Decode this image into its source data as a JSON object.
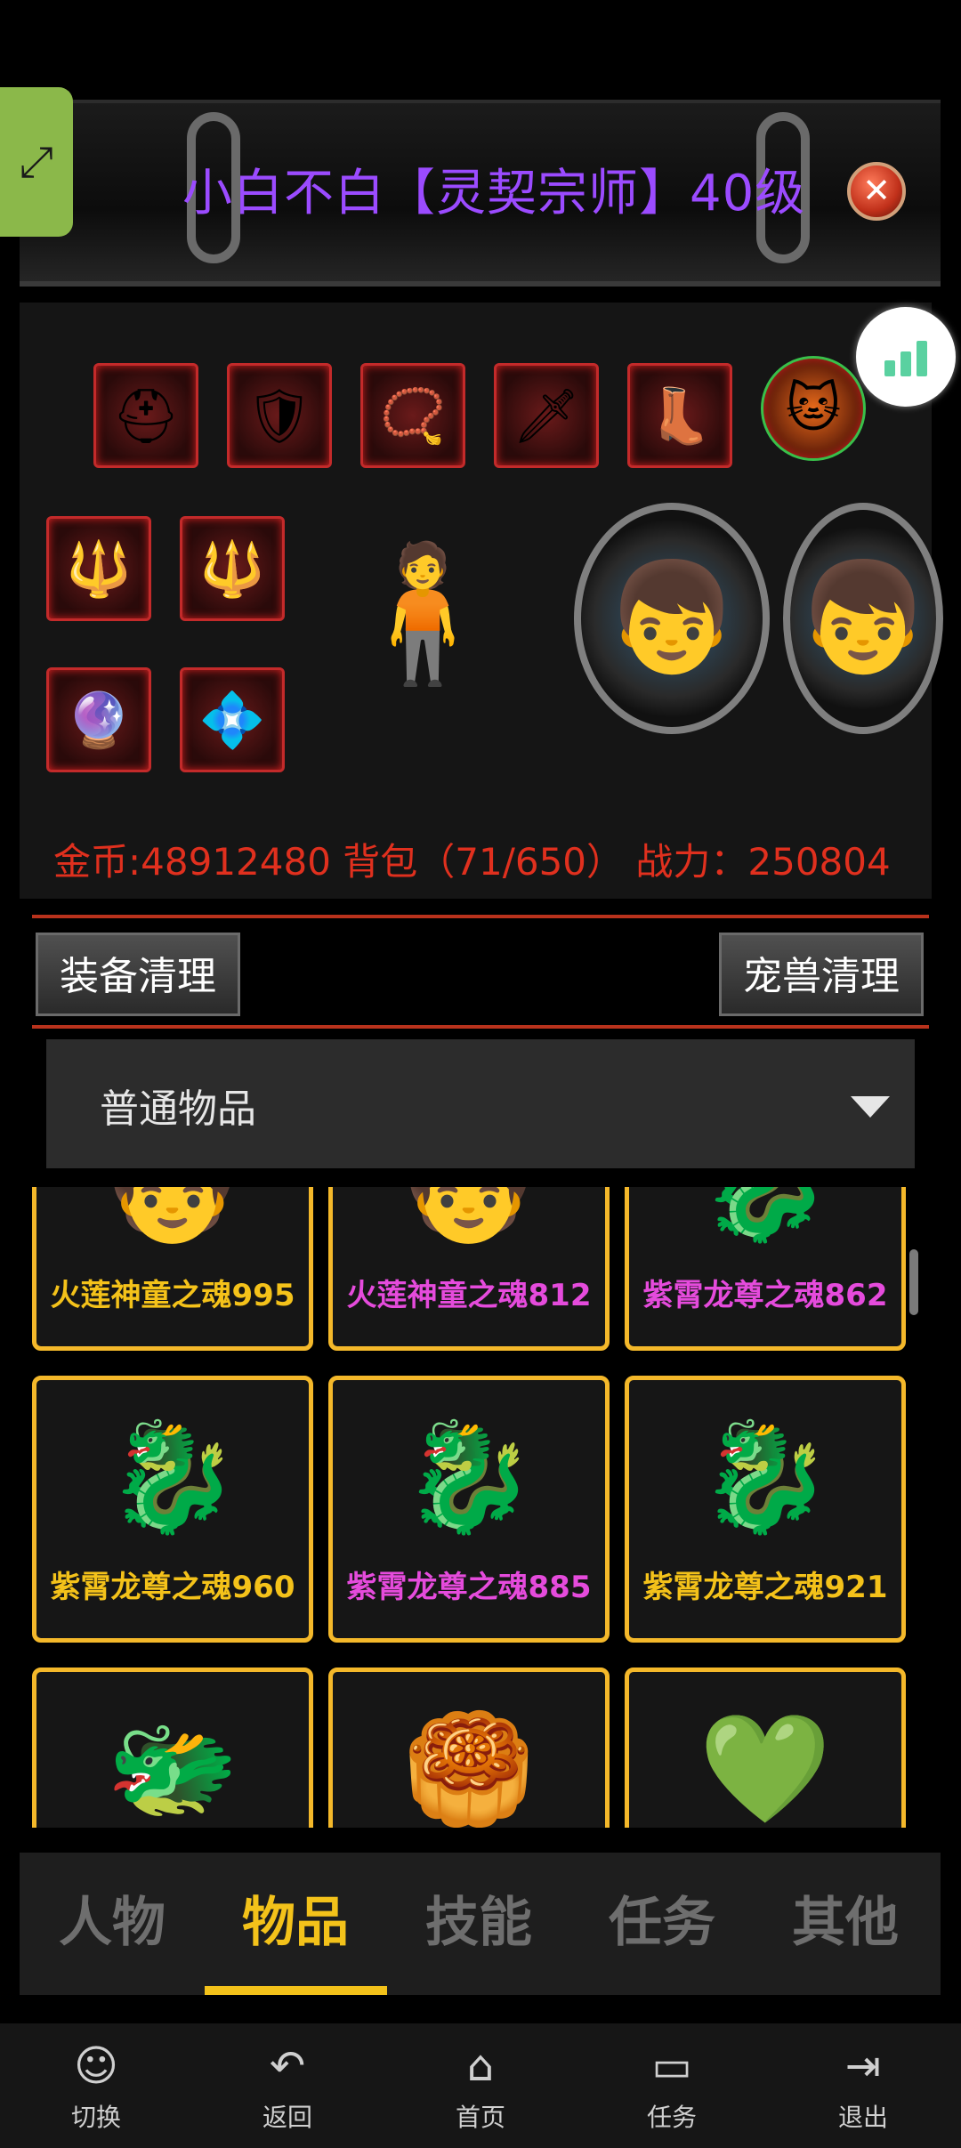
{
  "header": {
    "title": "小白不白【灵契宗师】40级",
    "expand_icon": "expand-icon",
    "close_icon": "close-icon",
    "stats_icon": "bar-chart-icon"
  },
  "stats": {
    "line": "金币:48912480 背包（71/650） 战力：250804"
  },
  "actions": {
    "equip_clean": "装备清理",
    "pet_clean": "宠兽清理"
  },
  "filter": {
    "selected": "普通物品"
  },
  "items": [
    {
      "label": "火莲神童之魂995",
      "color": "#f4c21a",
      "icon": "fire-lotus-boy"
    },
    {
      "label": "火莲神童之魂812",
      "color": "#e54bdc",
      "icon": "fire-lotus-boy"
    },
    {
      "label": "紫霄龙尊之魂862",
      "color": "#e54bdc",
      "icon": "purple-dragon"
    },
    {
      "label": "紫霄龙尊之魂960",
      "color": "#f4c21a",
      "icon": "purple-dragon"
    },
    {
      "label": "紫霄龙尊之魂885",
      "color": "#e54bdc",
      "icon": "purple-dragon"
    },
    {
      "label": "紫霄龙尊之魂921",
      "color": "#f4c21a",
      "icon": "purple-dragon"
    },
    {
      "label": "",
      "color": "#f4c21a",
      "icon": "green-dragon"
    },
    {
      "label": "",
      "color": "#f4c21a",
      "icon": "mooncake"
    },
    {
      "label": "",
      "color": "#f4c21a",
      "icon": "green-gem"
    }
  ],
  "tabs": [
    {
      "label": "人物",
      "active": false
    },
    {
      "label": "物品",
      "active": true
    },
    {
      "label": "技能",
      "active": false
    },
    {
      "label": "任务",
      "active": false
    },
    {
      "label": "其他",
      "active": false
    }
  ],
  "nav": [
    {
      "label": "切换",
      "icon": "switch-icon"
    },
    {
      "label": "返回",
      "icon": "back-icon"
    },
    {
      "label": "首页",
      "icon": "home-icon"
    },
    {
      "label": "任务",
      "icon": "task-icon"
    },
    {
      "label": "退出",
      "icon": "exit-icon"
    }
  ],
  "colors": {
    "accent": "#f3c21a",
    "title": "#9b4bff",
    "stat": "#e0301e",
    "item_border": "#f4b82a"
  }
}
